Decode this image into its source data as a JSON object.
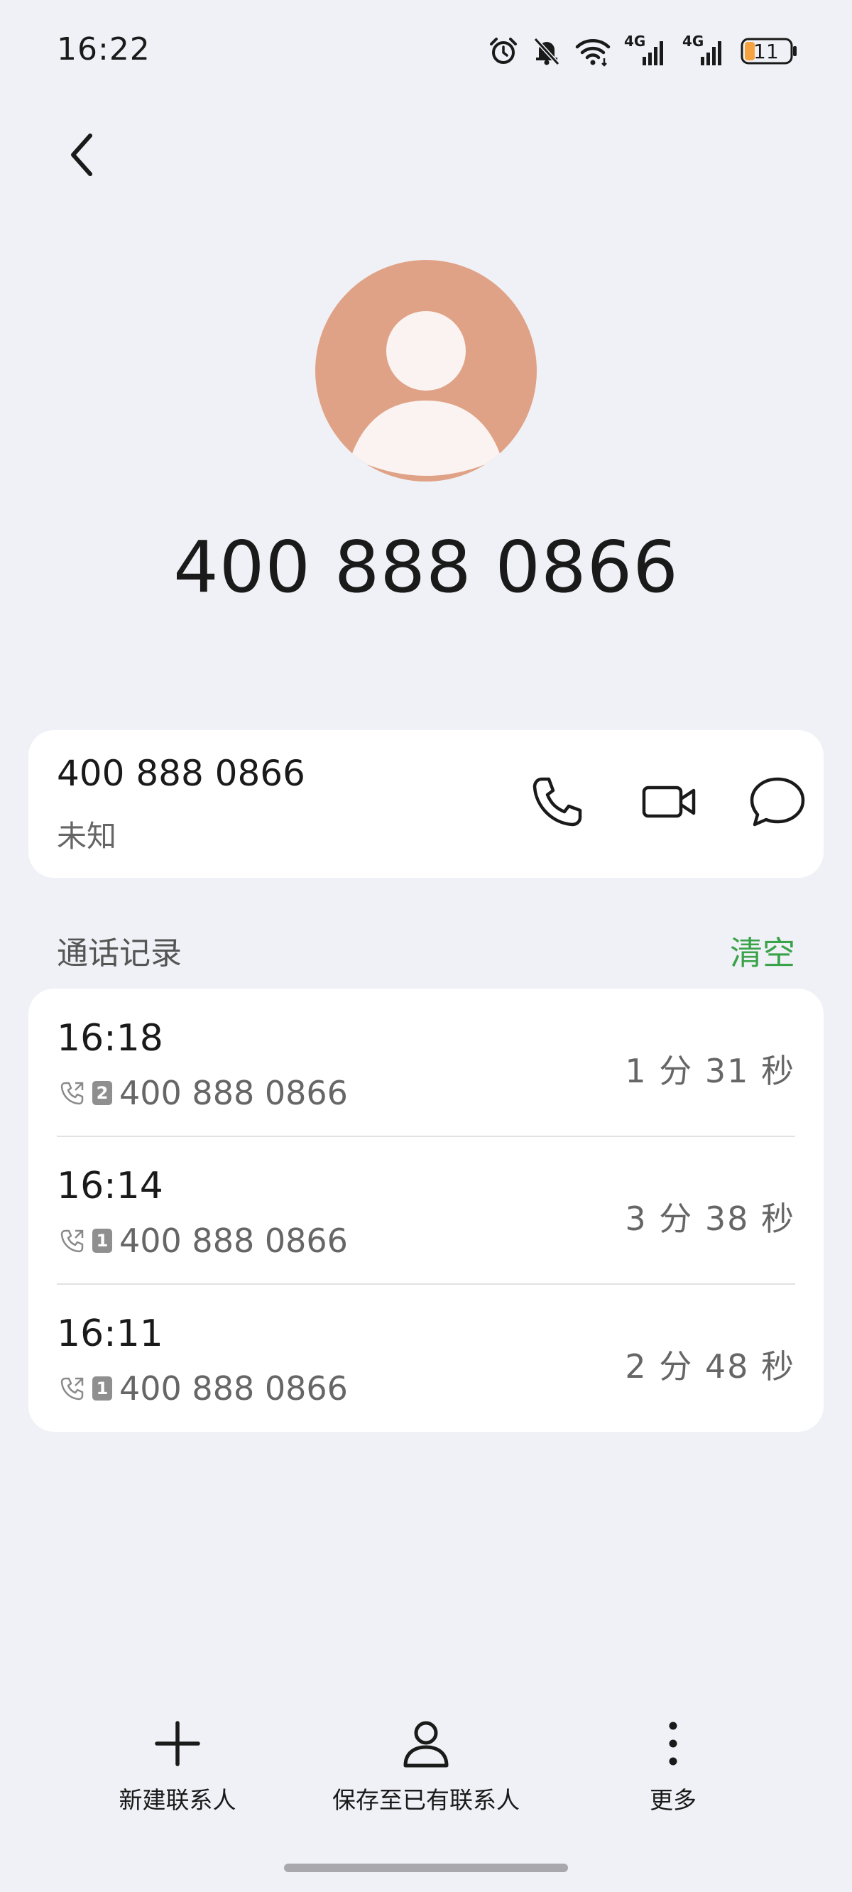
{
  "status_bar": {
    "time": "16:22",
    "network_1": "4G",
    "network_2": "4G",
    "battery": "11"
  },
  "header": {
    "number": "400 888 0866"
  },
  "contact_card": {
    "number": "400 888 0866",
    "label": "未知"
  },
  "call_log": {
    "title": "通话记录",
    "clear_label": "清空",
    "entries": [
      {
        "time": "16:18",
        "sim": "2",
        "number": "400 888 0866",
        "duration": "1 分 31 秒"
      },
      {
        "time": "16:14",
        "sim": "1",
        "number": "400 888 0866",
        "duration": "3 分 38 秒"
      },
      {
        "time": "16:11",
        "sim": "1",
        "number": "400 888 0866",
        "duration": "2 分 48 秒"
      }
    ]
  },
  "bottom_bar": {
    "new_contact": "新建联系人",
    "save_existing": "保存至已有联系人",
    "more": "更多"
  },
  "colors": {
    "background": "#f0f1f6",
    "accent_green": "#3aa34a",
    "avatar": "#e0a286",
    "battery_fill": "#f5a340"
  },
  "icons": [
    "alarm-icon",
    "mute-bell-icon",
    "wifi-icon",
    "signal-icon",
    "battery-icon",
    "back-arrow-icon",
    "phone-icon",
    "video-icon",
    "message-icon",
    "outgoing-call-icon",
    "plus-icon",
    "person-icon",
    "more-vertical-icon"
  ]
}
